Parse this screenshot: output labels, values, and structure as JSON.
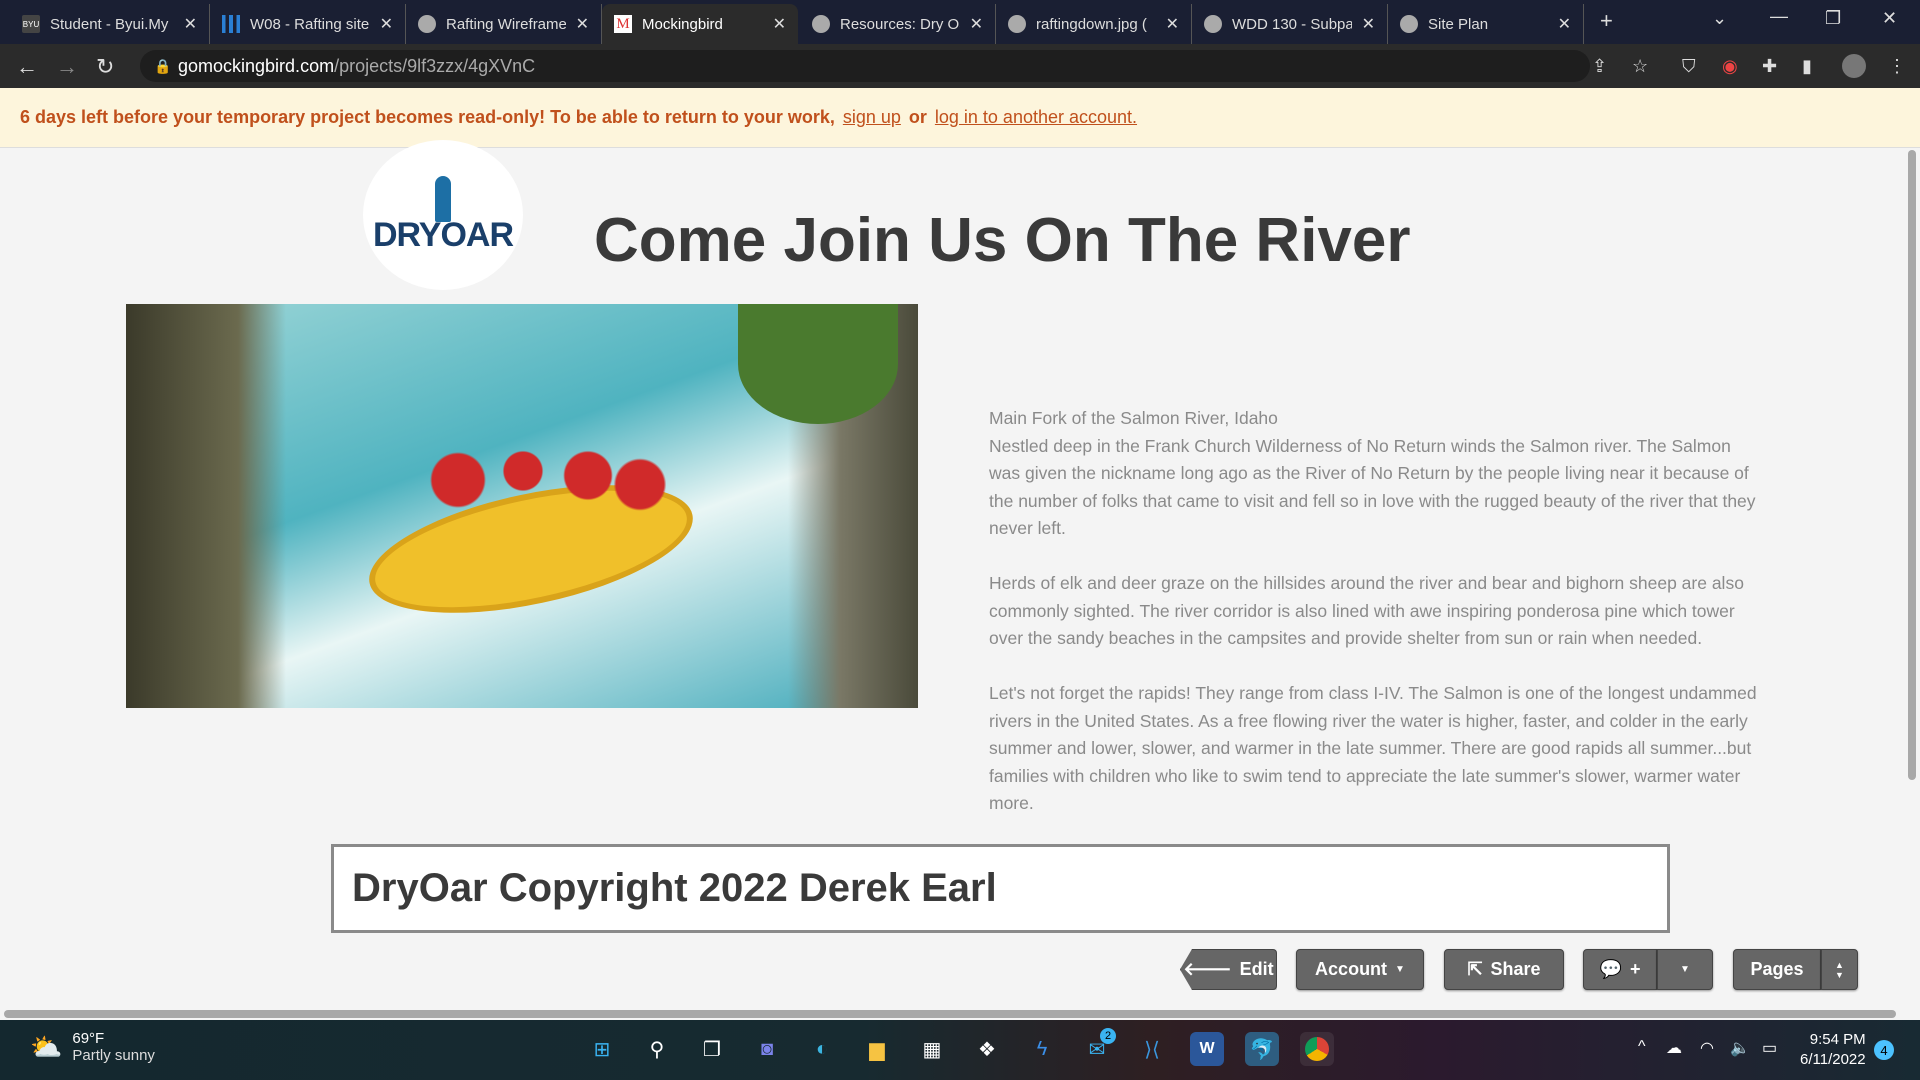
{
  "browser": {
    "tabs": [
      {
        "title": "Student - Byui.My",
        "icon": "byu-icon"
      },
      {
        "title": "W08 - Rafting site",
        "icon": "chart-icon"
      },
      {
        "title": "Rafting Wireframe",
        "icon": "globe-icon"
      },
      {
        "title": "Mockingbird",
        "icon": "mockingbird-icon",
        "active": true
      },
      {
        "title": "Resources: Dry Oar",
        "icon": "globe-icon"
      },
      {
        "title": "raftingdown.jpg (",
        "icon": "globe-icon"
      },
      {
        "title": "WDD 130 - Subpa",
        "icon": "globe-icon"
      },
      {
        "title": "Site Plan",
        "icon": "globe-icon"
      }
    ],
    "url_domain": "gomockingbird.com",
    "url_path": "/projects/9lf3zzx/4gXVnC"
  },
  "banner": {
    "message": "6 days left before your temporary project becomes read-only! To be able to return to your work,",
    "signup": "sign up",
    "or": "or",
    "login": "log in to another account."
  },
  "page": {
    "logo_text": "DRYOAR",
    "title": "Come Join Us On The River",
    "paragraphs": [
      "Main Fork of the Salmon River, Idaho",
      "Nestled deep in the Frank Church Wilderness of No Return winds the Salmon river. The Salmon was given the nickname long ago as the River of No Return by the people living near it because of the number of folks that came to visit and fell so in love with the rugged beauty of the river that they never left.",
      "Herds of elk and deer graze on the hillsides around the river and bear and bighorn sheep are also commonly sighted. The river corridor is also lined with awe inspiring ponderosa pine which tower over the sandy beaches in the campsites and provide shelter from sun or rain when needed.",
      "Let's not forget the rapids! They range from class I-IV. The Salmon is one of the longest undammed rivers in the United States. As a free flowing river the water is higher, faster, and colder in the early summer and lower, slower, and warmer in the late summer. There are good rapids all summer...but families with children who like to swim tend to appreciate the late summer's slower, warmer water more."
    ],
    "footer": "DryOar Copyright 2022 Derek Earl"
  },
  "toolbar": {
    "edit": "Edit",
    "account": "Account",
    "share": "Share",
    "comment_plus": "+",
    "pages": "Pages"
  },
  "taskbar": {
    "temp": "69°F",
    "weather": "Partly sunny",
    "mail_badge": "2",
    "time": "9:54 PM",
    "date": "6/11/2022",
    "notifications": "4"
  }
}
